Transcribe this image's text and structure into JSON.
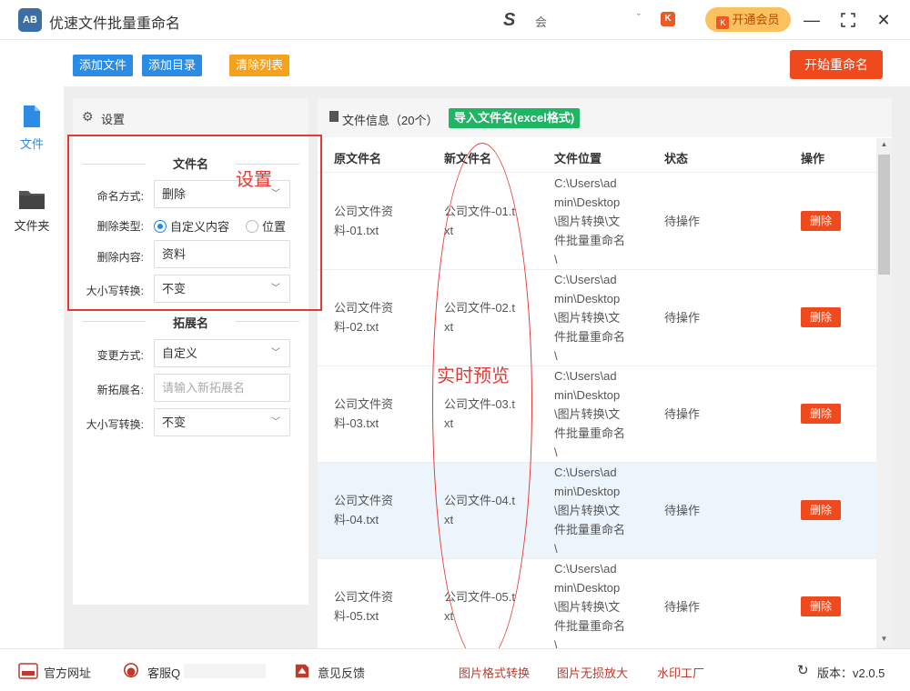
{
  "app": {
    "logo_text": "AB",
    "title": "优速文件批量重命名",
    "user_logo": "S",
    "user_name": "会",
    "dropdown_caret": "ˇ",
    "vip_label": "开通会员",
    "vip_badge": "K",
    "minimize": "—",
    "maximize": "⛶",
    "close": "✕"
  },
  "toolbar": {
    "add_file": "添加文件",
    "add_dir": "添加目录",
    "clear_list": "清除列表",
    "start_rename": "开始重命名"
  },
  "nav": {
    "file_label": "文件",
    "folder_label": "文件夹"
  },
  "settings": {
    "header": "设置",
    "filename_section": "文件名",
    "naming_method_label": "命名方式:",
    "naming_method_value": "删除",
    "delete_type_label": "删除类型:",
    "delete_type_option1": "自定义内容",
    "delete_type_option2": "位置",
    "delete_content_label": "删除内容:",
    "delete_content_value": "资料",
    "case_label": "大小写转换:",
    "case_value": "不变",
    "ext_section": "拓展名",
    "change_method_label": "变更方式:",
    "change_method_value": "自定义",
    "new_ext_label": "新拓展名:",
    "new_ext_placeholder": "请输入新拓展名",
    "ext_case_label": "大小写转换:",
    "ext_case_value": "不变"
  },
  "annotations": {
    "settings": "设置",
    "preview": "实时预览"
  },
  "fileinfo": {
    "header": "文件信息（20个）",
    "import_btn": "导入文件名(excel格式)",
    "columns": [
      "原文件名",
      "新文件名",
      "文件位置",
      "状态",
      "操作"
    ],
    "rows": [
      {
        "orig1": "公司文件资",
        "orig2": "料-01.txt",
        "new1": "公司文件-01.t",
        "new2": "xt",
        "loc": [
          "C:\\Users\\ad",
          "min\\Desktop",
          "\\图片转换\\文",
          "件批量重命名",
          "\\"
        ],
        "status": "待操作",
        "action": "删除"
      },
      {
        "orig1": "公司文件资",
        "orig2": "料-02.txt",
        "new1": "公司文件-02.t",
        "new2": "xt",
        "loc": [
          "C:\\Users\\ad",
          "min\\Desktop",
          "\\图片转换\\文",
          "件批量重命名",
          "\\"
        ],
        "status": "待操作",
        "action": "删除"
      },
      {
        "orig1": "公司文件资",
        "orig2": "料-03.txt",
        "new1": "公司文件-03.t",
        "new2": "xt",
        "loc": [
          "C:\\Users\\ad",
          "min\\Desktop",
          "\\图片转换\\文",
          "件批量重命名",
          "\\"
        ],
        "status": "待操作",
        "action": "删除"
      },
      {
        "orig1": "公司文件资",
        "orig2": "料-04.txt",
        "new1": "公司文件-04.t",
        "new2": "xt",
        "loc": [
          "C:\\Users\\ad",
          "min\\Desktop",
          "\\图片转换\\文",
          "件批量重命名",
          "\\"
        ],
        "status": "待操作",
        "action": "删除"
      },
      {
        "orig1": "公司文件资",
        "orig2": "料-05.txt",
        "new1": "公司文件-05.t",
        "new2": "xt",
        "loc": [
          "C:\\Users\\ad",
          "min\\Desktop",
          "\\图片转换\\文",
          "件批量重命名",
          "\\"
        ],
        "status": "待操作",
        "action": "删除"
      }
    ]
  },
  "footer": {
    "website": "官方网址",
    "support": "客服Q",
    "feedback": "意见反馈",
    "link1": "图片格式转换",
    "link2": "图片无损放大",
    "link3": "水印工厂",
    "version": "版本：v2.0.5"
  },
  "colors": {
    "primary_blue": "#2b8ce6",
    "orange": "#f5a11c",
    "red": "#ee4a1e",
    "green": "#1fb564",
    "annotation_red": "#e53935"
  }
}
